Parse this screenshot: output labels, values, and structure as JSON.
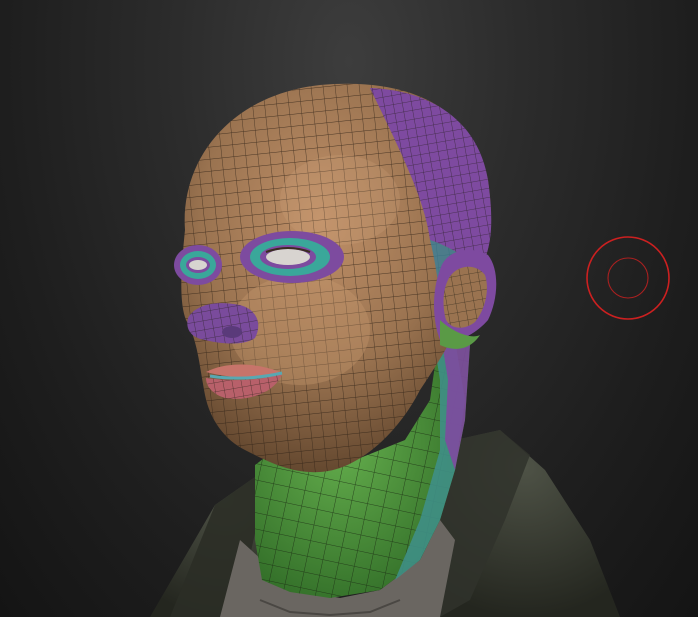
{
  "viewport": {
    "background_color": "#2a2a2a"
  },
  "model": {
    "polygroup_colors": {
      "skin": "#9a7350",
      "skin_light": "#b58a63",
      "back_of_head": "#7e4aa0",
      "eye_socket_inner": "#3aa79a",
      "eye_socket_outer": "#7d4b9f",
      "nostril": "#7a4b9c",
      "lips": "#c7746a",
      "lip_line": "#58a8b2",
      "neck_front": "#4f9a40",
      "neck_side": "#3f8f86",
      "ear": "#5a9a46",
      "jacket": "#3b3f36",
      "shirt": "#6a6661",
      "wire_color": "#2a1e14"
    }
  },
  "cursor": {
    "brush_icon": "brush-radius-circle",
    "color": "#cc2020"
  }
}
